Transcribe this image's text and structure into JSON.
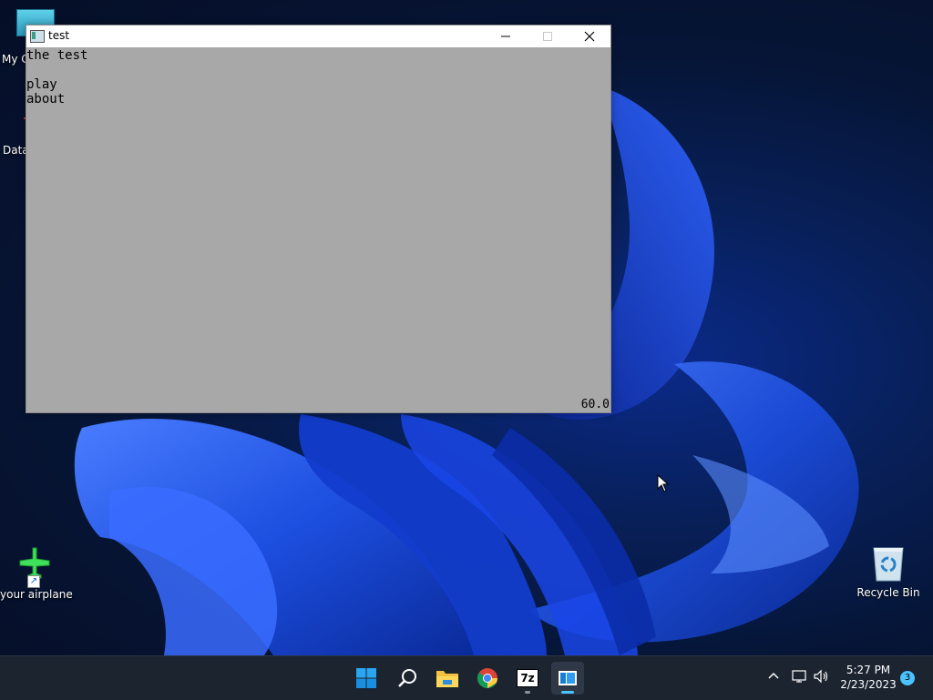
{
  "desktop": {
    "icons": [
      {
        "label": "My C",
        "icon": "computer-icon"
      },
      {
        "label": "Data",
        "icon": "data-app-icon"
      },
      {
        "label": "your airplane",
        "icon": "airplane-icon"
      },
      {
        "label": "Recycle Bin",
        "icon": "recycle-bin-icon"
      }
    ]
  },
  "window": {
    "title": "test",
    "icon": "app-window-icon",
    "buttons": {
      "minimize": "minimize-icon",
      "maximize": "maximize-icon",
      "close": "close-icon"
    },
    "client": {
      "background": "#a8a8a8",
      "heading": "the test",
      "menu": [
        "play",
        "about"
      ],
      "fps": "60.0"
    }
  },
  "taskbar": {
    "apps": [
      "start-icon",
      "search-icon",
      "file-explorer-icon",
      "chrome-icon",
      "7zip-icon",
      "test-app-icon"
    ],
    "tray": {
      "chevron": "chevron-up-icon",
      "network": "network-icon",
      "volume": "volume-icon",
      "time": "5:27 PM",
      "date": "2/23/2023",
      "notifications": "3"
    }
  },
  "colors": {
    "accent": "#4cc2ff",
    "taskbar": "#1c2430"
  }
}
